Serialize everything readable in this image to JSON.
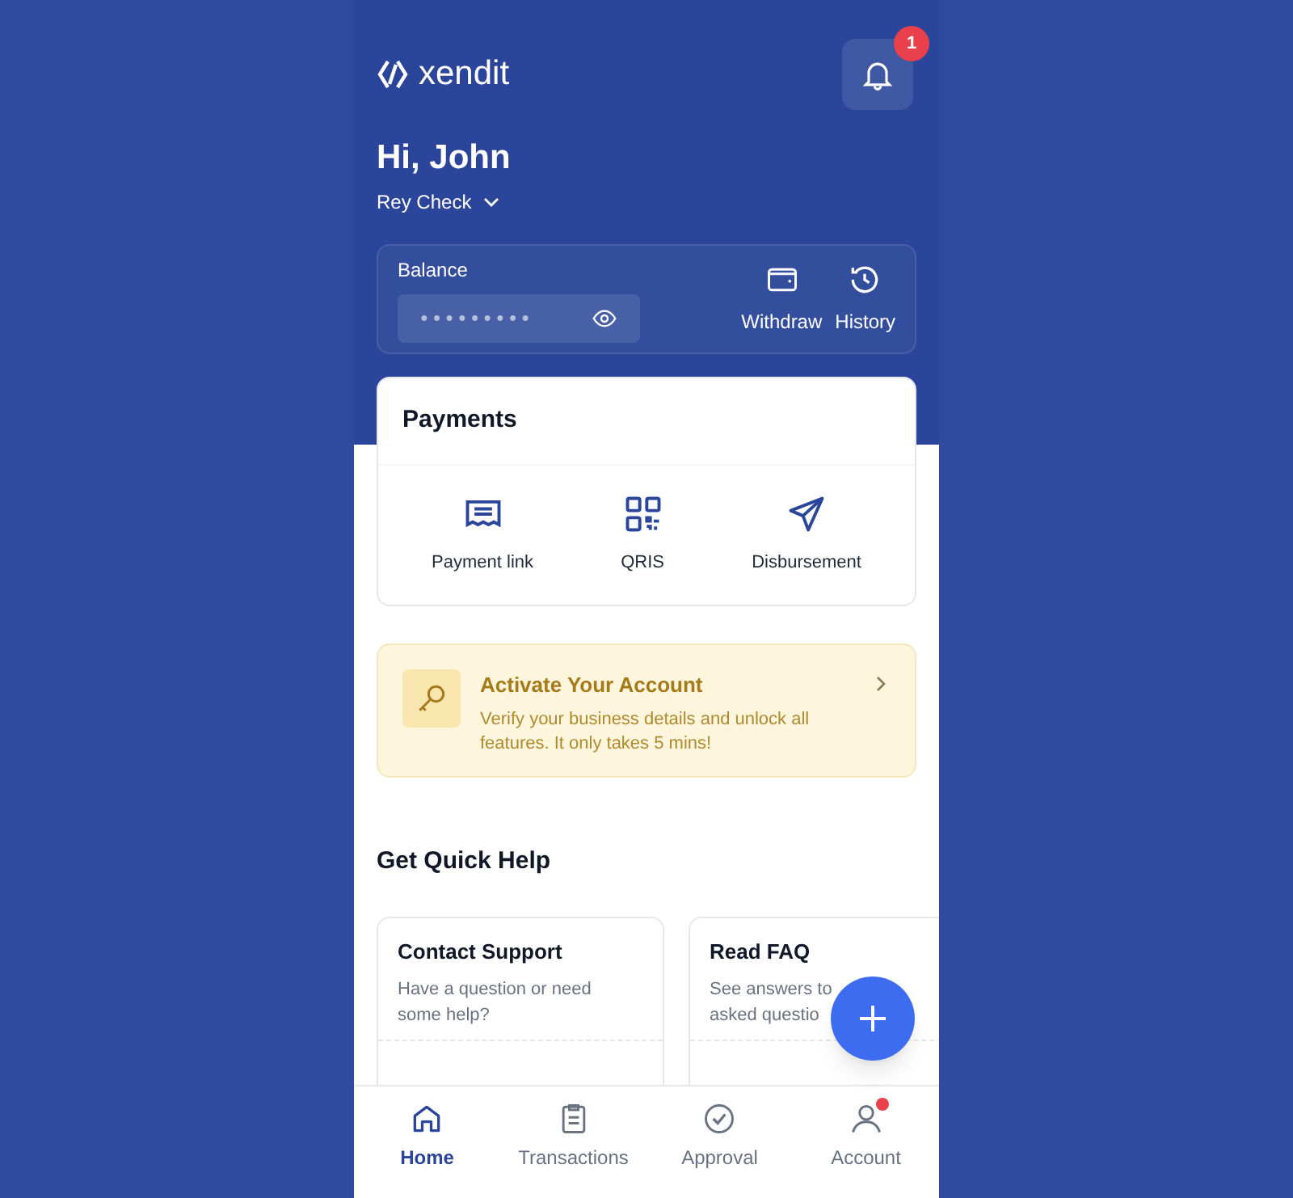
{
  "header": {
    "brand": "xendit",
    "notification_count": "1",
    "greeting": "Hi, John",
    "business": "Rey Check"
  },
  "balance": {
    "label": "Balance",
    "masked": "●●●●●●●●●",
    "actions": [
      {
        "label": "Withdraw"
      },
      {
        "label": "History"
      }
    ]
  },
  "payments": {
    "title": "Payments",
    "items": [
      {
        "label": "Payment link"
      },
      {
        "label": "QRIS"
      },
      {
        "label": "Disbursement"
      }
    ]
  },
  "activation": {
    "title": "Activate Your Account",
    "text": "Verify your business details and unlock all features. It only takes 5 mins!"
  },
  "quick_help": {
    "title": "Get Quick Help",
    "cards": [
      {
        "title": "Contact Support",
        "lines": [
          "Have a question or need",
          "some help?"
        ]
      },
      {
        "title": "Read FAQ",
        "lines": [
          "See answers to",
          "asked questio"
        ]
      }
    ]
  },
  "nav": [
    {
      "label": "Home",
      "selected": true,
      "badge": false
    },
    {
      "label": "Transactions",
      "selected": false,
      "badge": false
    },
    {
      "label": "Approval",
      "selected": false,
      "badge": false
    },
    {
      "label": "Account",
      "selected": false,
      "badge": true
    }
  ]
}
